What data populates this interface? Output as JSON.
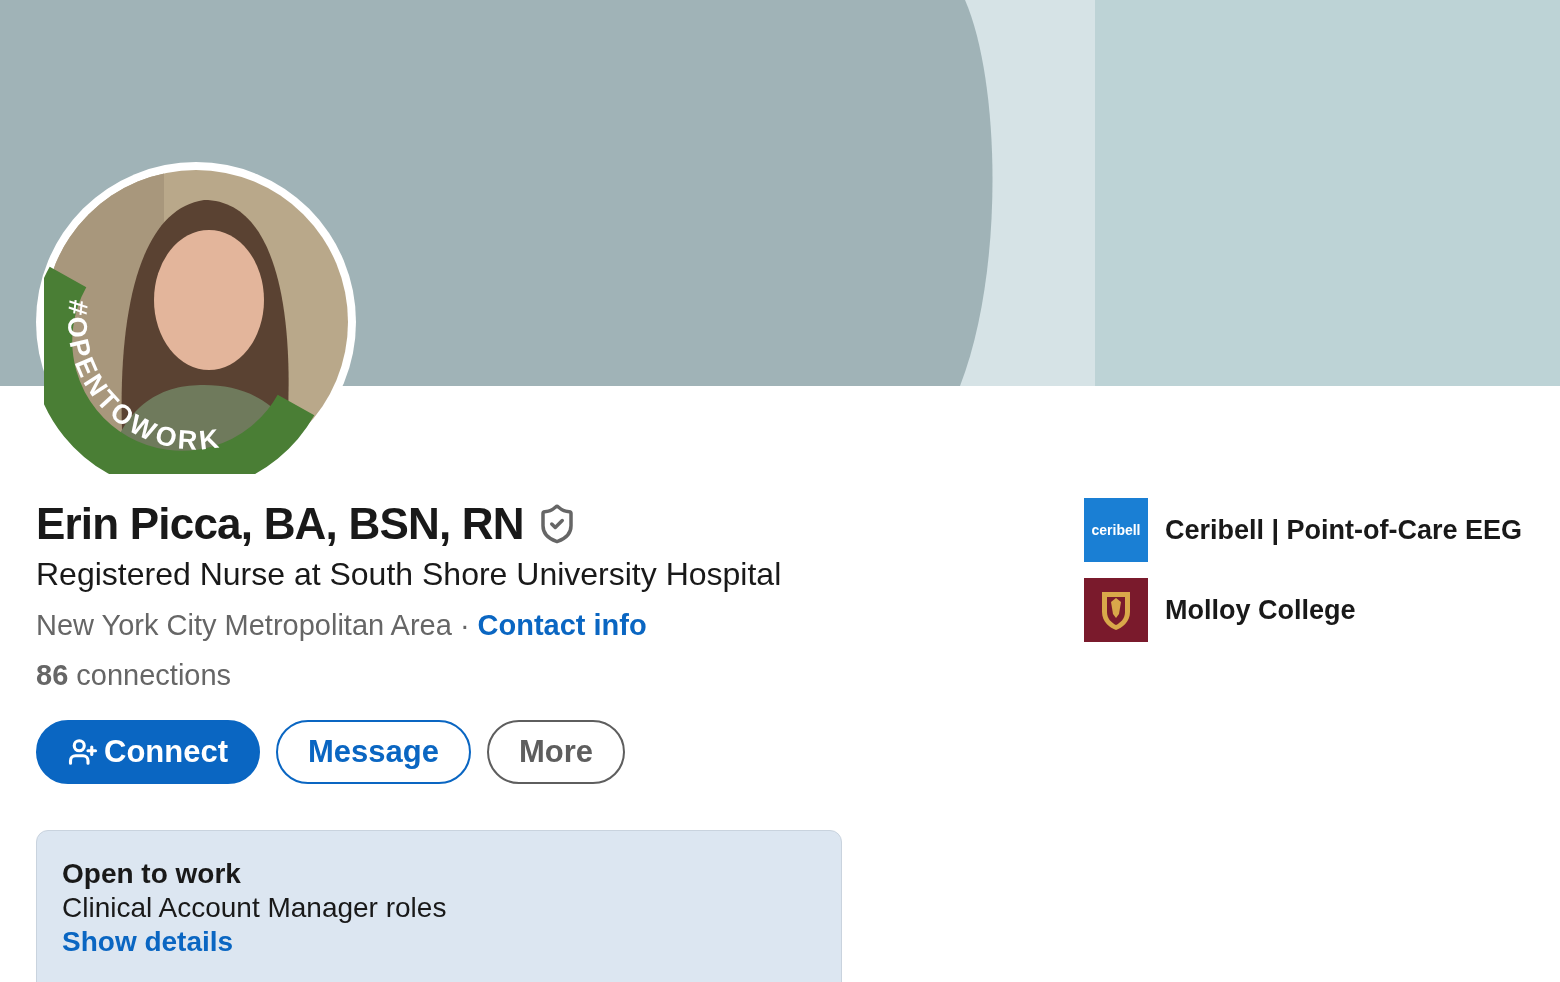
{
  "profile": {
    "frame_label": "#OPENTOWORK",
    "name": "Erin Picca, BA, BSN, RN",
    "headline": "Registered Nurse at South Shore University Hospital",
    "location": "New York City Metropolitan Area",
    "separator": "·",
    "contact_link": "Contact info",
    "connections": "**86** connections"
  },
  "buttons": [
    {
      "kind": "primary",
      "label": "Connect"
    },
    {
      "kind": "outline",
      "label": "Message"
    },
    {
      "kind": "secondary",
      "label": "More"
    }
  ],
  "open_to_work": {
    "title": "Open to work",
    "roles": "Clinical Account Manager roles",
    "link": "Show details"
  },
  "affiliations": [
    {
      "kind": "company",
      "logo_text": "ceribell",
      "name": "Ceribell | Point-of-Care EEG"
    },
    {
      "kind": "school",
      "name": "Molloy College"
    }
  ]
}
